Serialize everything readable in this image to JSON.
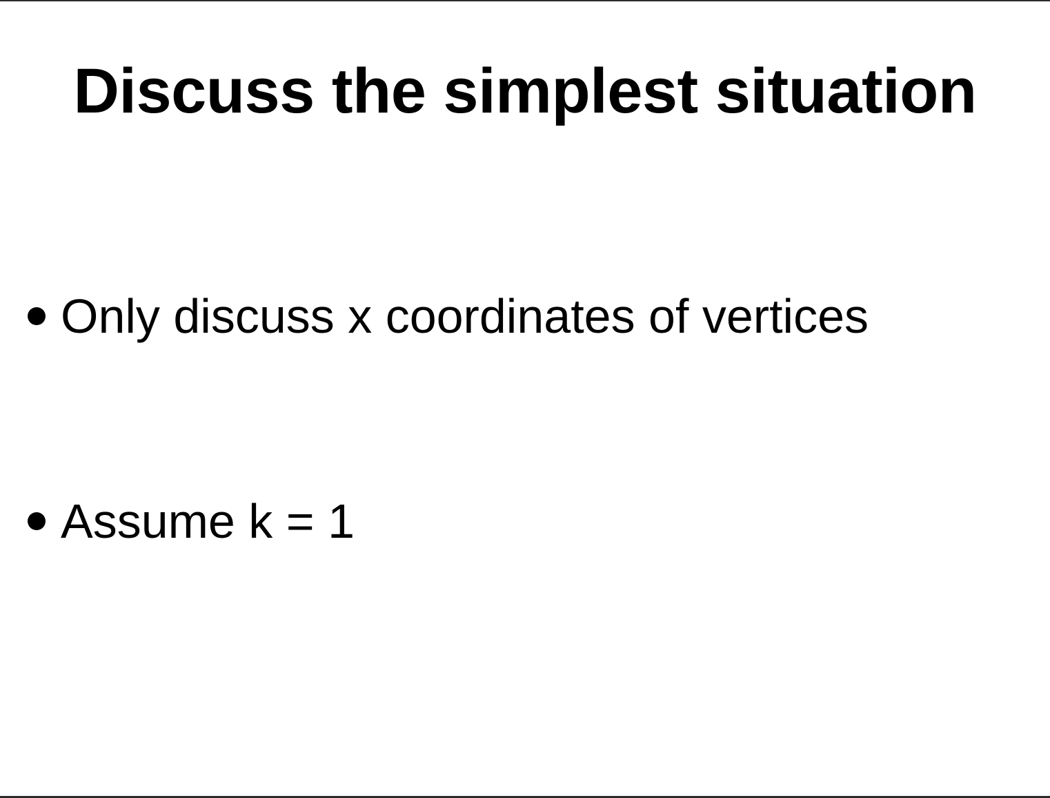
{
  "slide": {
    "title": "Discuss the simplest situation",
    "bullets": [
      {
        "text": "Only discuss x coordinates of vertices"
      },
      {
        "text": "Assume k = 1"
      }
    ]
  },
  "colors": {
    "background": "#ffffff",
    "text": "#000000",
    "border": "#2b2b2b"
  },
  "icons": {
    "bullet": "bullet-dot-icon"
  }
}
